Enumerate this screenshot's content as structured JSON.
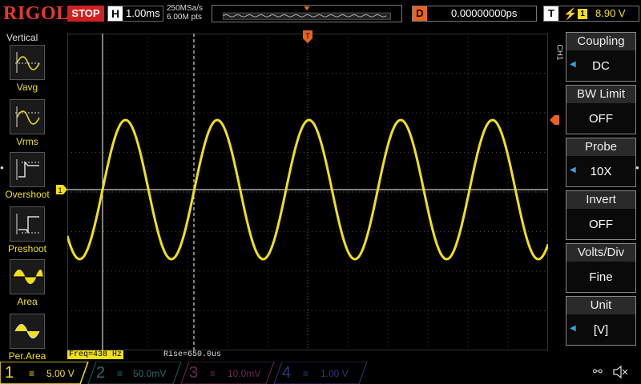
{
  "brand": "RIGOL",
  "run_state": "STOP",
  "horizontal": {
    "label": "H",
    "timebase": "1.00ms"
  },
  "sample": {
    "rate": "250MSa/s",
    "points": "6.00M pts"
  },
  "delay": {
    "label": "D",
    "value": "0.00000000ps"
  },
  "trigger": {
    "label": "T",
    "source": "1",
    "level": "8.90 V"
  },
  "left_menu": {
    "title": "Vertical",
    "items": [
      {
        "label": "Vavg",
        "icon": "vavg-icon"
      },
      {
        "label": "Vrms",
        "icon": "vrms-icon"
      },
      {
        "label": "Overshoot",
        "icon": "overshoot-icon"
      },
      {
        "label": "Preshoot",
        "icon": "preshoot-icon"
      },
      {
        "label": "Area",
        "icon": "area-icon"
      },
      {
        "label": "Per.Area",
        "icon": "per-area-icon"
      }
    ]
  },
  "right_menu": {
    "channel": "CH1",
    "items": [
      {
        "title": "Coupling",
        "value": "DC"
      },
      {
        "title": "BW Limit",
        "value": "OFF"
      },
      {
        "title": "Probe",
        "value": "10X"
      },
      {
        "title": "Invert",
        "value": "OFF"
      },
      {
        "title": "Volts/Div",
        "value": "Fine"
      },
      {
        "title": "Unit",
        "value": "[V]"
      }
    ]
  },
  "measurements": {
    "freq": "Freq=438 Hz",
    "rise": "Rise=650.0us"
  },
  "channels": [
    {
      "num": "1",
      "scale": "5.00 V",
      "color": "#f0e018"
    },
    {
      "num": "2",
      "scale": "50.0mV",
      "color": "#2a9a9a"
    },
    {
      "num": "3",
      "scale": "10.0mV",
      "color": "#a03a8a"
    },
    {
      "num": "4",
      "scale": "1.00 V",
      "color": "#3a66c0"
    }
  ],
  "colors": {
    "ch1": "#f0e018",
    "accent": "#e8641c",
    "grid": "#555555"
  }
}
